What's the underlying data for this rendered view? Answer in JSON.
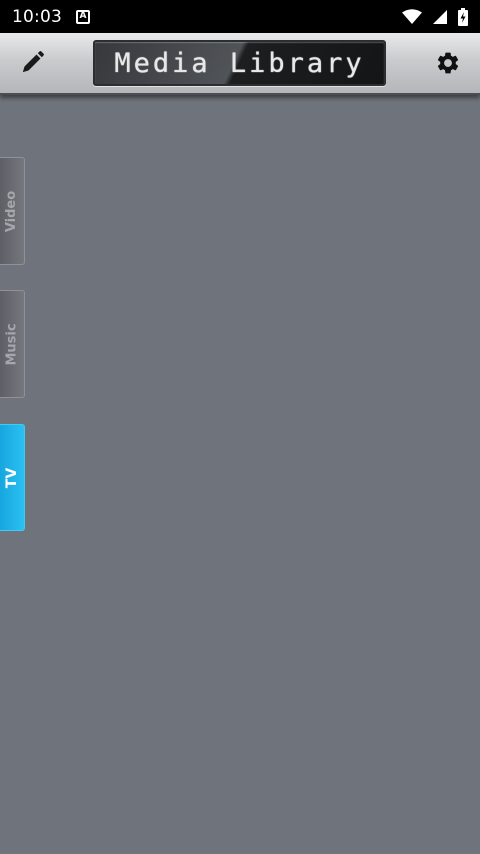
{
  "status_bar": {
    "time": "10:03",
    "notification_icon_letter": "A",
    "icons": [
      "wifi-icon",
      "signal-icon",
      "battery-charging-icon"
    ]
  },
  "toolbar": {
    "title": "Media Library",
    "left_icon": "pencil-icon",
    "right_icon": "gear-icon"
  },
  "side_tabs": [
    {
      "label": "Video",
      "selected": false
    },
    {
      "label": "Music",
      "selected": false
    },
    {
      "label": "TV",
      "selected": true
    }
  ],
  "colors": {
    "accent": "#1fb3ea",
    "background": "#6f737b"
  }
}
